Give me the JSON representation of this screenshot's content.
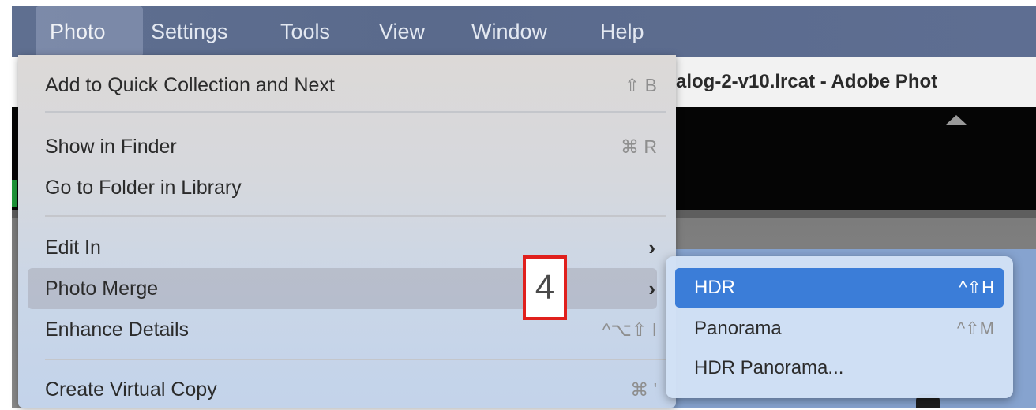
{
  "menubar": {
    "items": [
      {
        "label": "Photo",
        "active": true
      },
      {
        "label": "Settings"
      },
      {
        "label": "Tools"
      },
      {
        "label": "View"
      },
      {
        "label": "Window"
      },
      {
        "label": "Help"
      }
    ]
  },
  "background_window": {
    "title": "alog-2-v10.lrcat - Adobe Phot"
  },
  "photo_menu": {
    "items": [
      {
        "label": "Add to Quick Collection and Next",
        "shortcut": "⇧ B"
      },
      {
        "label": "Show in Finder",
        "shortcut": "⌘ R"
      },
      {
        "label": "Go to Folder in Library",
        "shortcut": ""
      },
      {
        "label": "Edit In",
        "submenu_arrow": "›"
      },
      {
        "label": "Photo Merge",
        "submenu_arrow": "›"
      },
      {
        "label": "Enhance Details",
        "shortcut": "^⌥⇧ I"
      },
      {
        "label": "Create Virtual Copy",
        "shortcut": "⌘ '"
      }
    ]
  },
  "photo_merge_submenu": {
    "items": [
      {
        "label": "HDR",
        "shortcut": "^⇧H",
        "selected": true
      },
      {
        "label": "Panorama",
        "shortcut": "^⇧M"
      },
      {
        "label": "HDR Panorama...",
        "shortcut": ""
      }
    ]
  },
  "annotation": {
    "step_number": "4",
    "color": "#e0201d"
  },
  "colors": {
    "menubar_bg": "#5f6f90",
    "selection_blue": "#3b7dd8"
  }
}
